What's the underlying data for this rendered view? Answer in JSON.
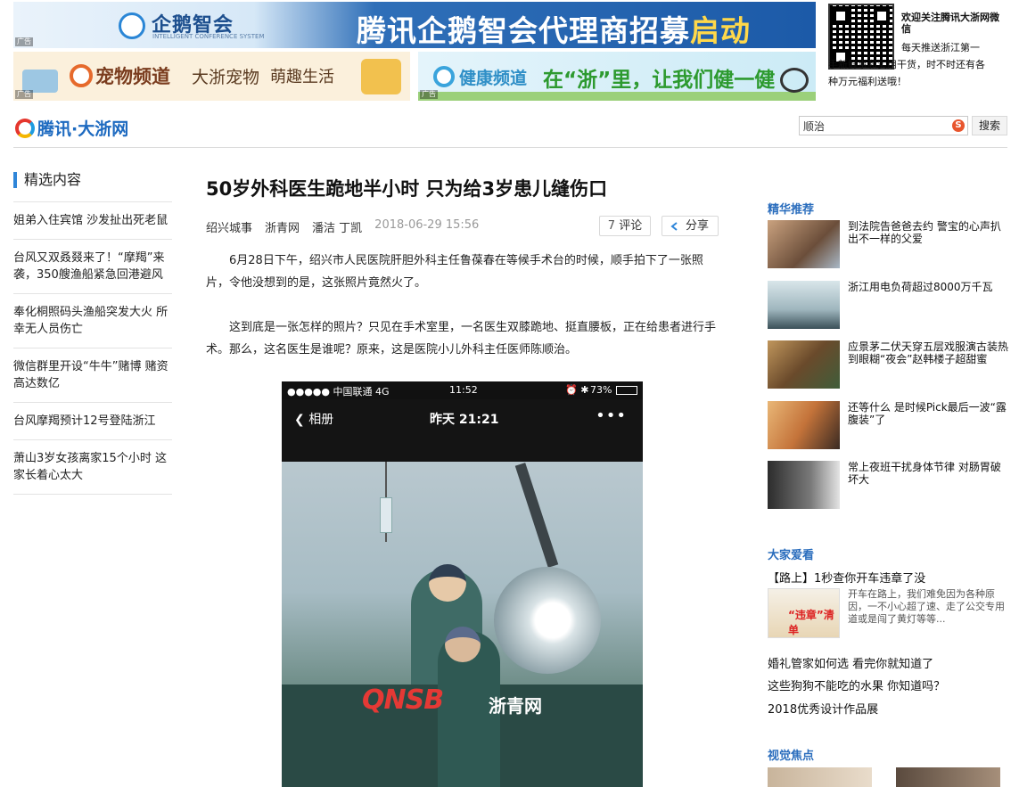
{
  "ads": {
    "top": {
      "logo_text": "企鹅智会",
      "logo_sub": "INTELLIGENT CONFERENCE SYSTEM",
      "headline_a": "腾讯企鹅智会代理商招募",
      "headline_b": "启动",
      "tag": "广告"
    },
    "pet": {
      "channel": "宠物频道",
      "slogan_a": "大浙宠物",
      "slogan_b": "萌趣生活",
      "tag": "广告"
    },
    "health": {
      "channel": "健康频道",
      "slogan": "在“浙”里，让我们健一健",
      "tag": "广告"
    }
  },
  "wechat": {
    "title": "欢迎关注腾讯大浙网微信",
    "desc": "每天推送浙江第一手新鲜事和实用干货，时不时还有各种万元福利送哦！"
  },
  "header": {
    "logo": "腾讯·大浙网",
    "search_value": "顺治",
    "search_button": "搜索"
  },
  "left": {
    "title": "精选内容",
    "items": [
      "姐弟入住宾馆 沙发扯出死老鼠",
      "台风又双叒叕来了！“摩羯”来袭，350艘渔船紧急回港避风",
      "奉化桐照码头渔船突发大火 所幸无人员伤亡",
      "微信群里开设“牛牛”赌博 赌资高达数亿",
      "台风摩羯预计12号登陆浙江",
      "萧山3岁女孩离家15个小时 这家长着心太大"
    ]
  },
  "article": {
    "title": "50岁外科医生跪地半小时 只为给3岁患儿缝伤口",
    "meta": {
      "category": "绍兴城事",
      "source": "浙青网",
      "authors": "潘洁 丁凯",
      "date": "2018-06-29 15:56"
    },
    "comment_count": "7",
    "comment_label": "评论",
    "share_label": "分享",
    "paragraphs": [
      "6月28日下午，绍兴市人民医院肝胆外科主任鲁葆春在等候手术台的时候，顺手拍下了一张照片，令他没想到的是，这张照片竟然火了。",
      "这到底是一张怎样的照片？只见在手术室里，一名医生双膝跪地、挺直腰板，正在给患者进行手术。那么，这名医生是谁呢？原来，这是医院小儿外科主任医师陈顺治。"
    ],
    "photo": {
      "carrier": "●●●●● 中国联通  4G",
      "time": "11:52",
      "battery": "73%",
      "back": "相册",
      "nav_title": "昨天 21:21",
      "more": "•••",
      "watermark_a": "QNSB",
      "watermark_b": "浙青网"
    }
  },
  "right": {
    "rec_title": "精华推荐",
    "recs": [
      "到法院告爸爸去约 警宝的心声扒出不一样的父爱",
      "浙江用电负荷超过8000万千瓦",
      "应景茅二伏天穿五层戏服演古装热到眼糊“夜会”赵韩楼子超甜蜜",
      "还等什么 是时候Pick最后一波“露腹装”了",
      "常上夜班干扰身体节律 对肠胃破坏大"
    ],
    "love_title": "大家爱看",
    "love_first": "【路上】1秒查你开车违章了没",
    "love_thumb_text": "“违章”清单",
    "love_desc": "开车在路上，我们难免因为各种原因，一不小心超了速、走了公交专用道或是闯了黄灯等等...",
    "love_links": [
      "婚礼管家如何选 看完你就知道了",
      "这些狗狗不能吃的水果 你知道吗？",
      "2018优秀设计作品展"
    ],
    "visual_title": "视觉焦点"
  }
}
